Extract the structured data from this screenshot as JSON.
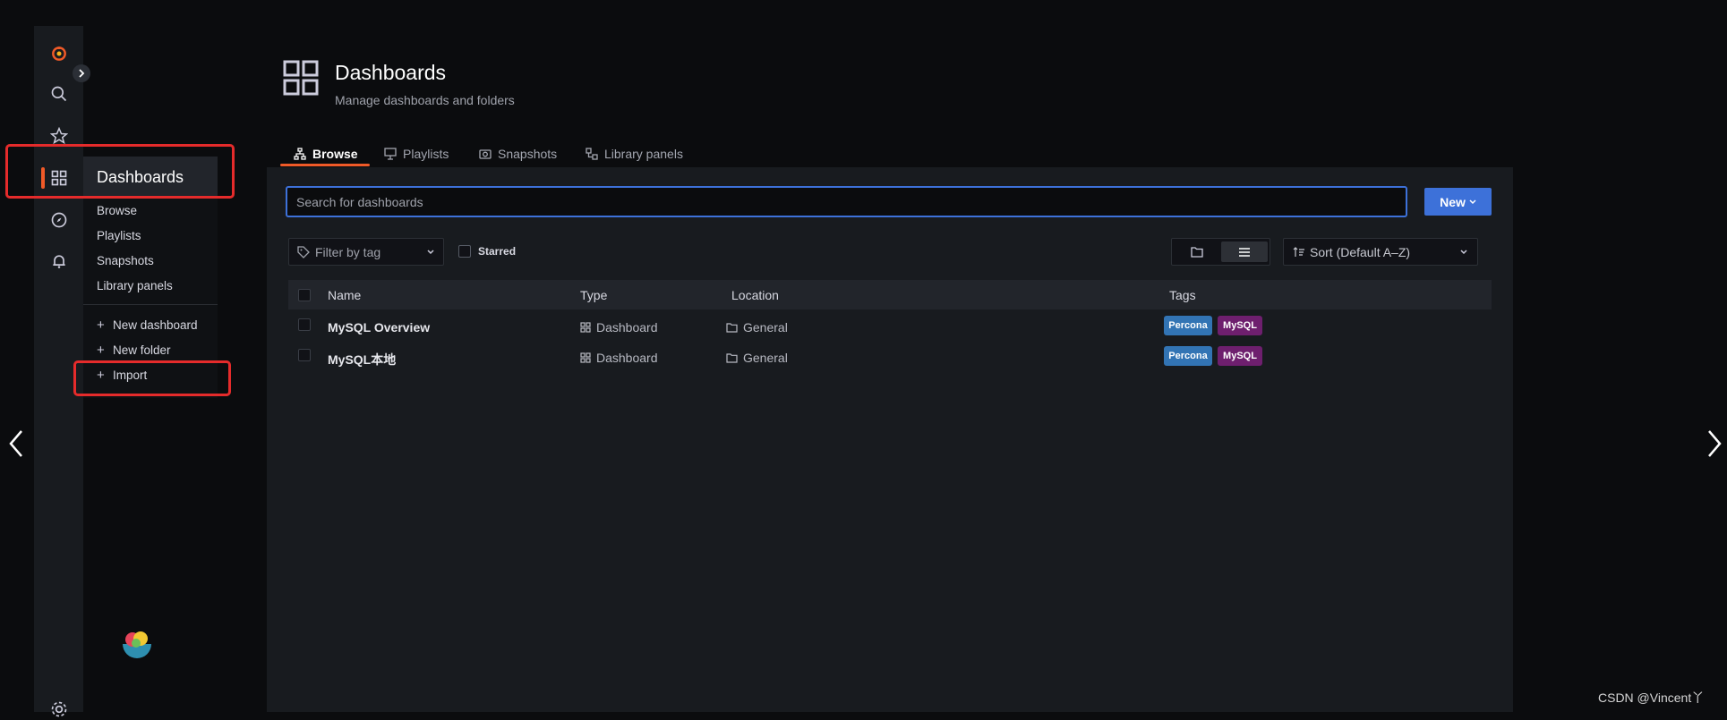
{
  "sidebar": {
    "icons": [
      "grafana-logo-icon",
      "search-icon",
      "star-icon",
      "dashboards-icon",
      "explore-icon",
      "alert-bell-icon",
      "gear-icon"
    ]
  },
  "flyout": {
    "title": "Dashboards",
    "items": [
      {
        "label": "Browse"
      },
      {
        "label": "Playlists"
      },
      {
        "label": "Snapshots"
      },
      {
        "label": "Library panels"
      }
    ],
    "actions": [
      {
        "label": "New dashboard"
      },
      {
        "label": "New folder"
      },
      {
        "label": "Import"
      }
    ]
  },
  "header": {
    "title": "Dashboards",
    "subtitle": "Manage dashboards and folders"
  },
  "tabs": [
    {
      "label": "Browse",
      "active": true
    },
    {
      "label": "Playlists",
      "active": false
    },
    {
      "label": "Snapshots",
      "active": false
    },
    {
      "label": "Library panels",
      "active": false
    }
  ],
  "search": {
    "placeholder": "Search for dashboards"
  },
  "new_button": {
    "label": "New"
  },
  "filters": {
    "tag_placeholder": "Filter by tag",
    "starred_label": "Starred",
    "sort_label": "Sort (Default A–Z)"
  },
  "table": {
    "columns": [
      "Name",
      "Type",
      "Location",
      "Tags"
    ],
    "rows": [
      {
        "name": "MySQL Overview",
        "type": "Dashboard",
        "location": "General",
        "tags": [
          "Percona",
          "MySQL"
        ]
      },
      {
        "name": "MySQL本地",
        "type": "Dashboard",
        "location": "General",
        "tags": [
          "Percona",
          "MySQL"
        ]
      }
    ]
  },
  "tag_colors": {
    "Percona": "#3274b4",
    "MySQL": "#6e1f6e"
  },
  "accent_color": "#f05a28",
  "primary_color": "#3d71d9",
  "watermark": "CSDN @Vincent丫"
}
